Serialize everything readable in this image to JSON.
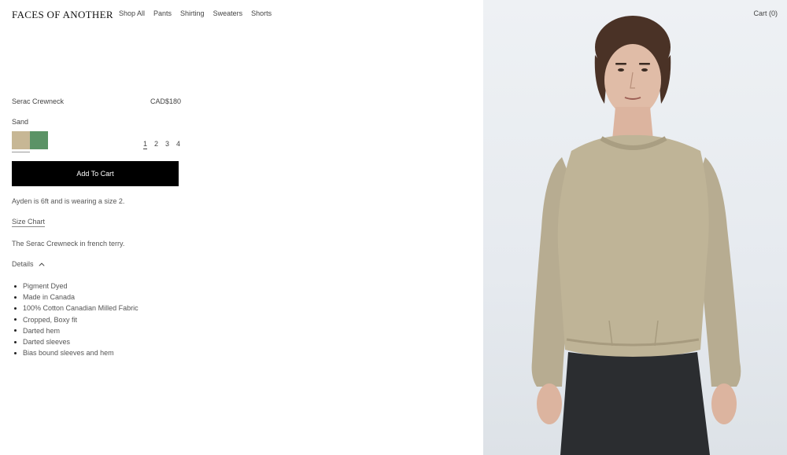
{
  "brand": "FACES OF ANOTHER",
  "nav": [
    "Shop All",
    "Pants",
    "Shirting",
    "Sweaters",
    "Shorts"
  ],
  "cart": "Cart (0)",
  "product": {
    "name": "Serac Crewneck",
    "price": "CAD$180",
    "color": "Sand",
    "swatch_colors": [
      "#c7b795",
      "#5b9366"
    ],
    "sizes": [
      "1",
      "2",
      "3",
      "4"
    ],
    "add_to_cart": "Add To Cart",
    "model_note": "Ayden is 6ft and is wearing a size 2.",
    "size_chart": "Size Chart",
    "description": "The Serac Crewneck in french terry.",
    "details_label": "Details",
    "details": [
      "Pigment Dyed",
      "Made in Canada",
      "100% Cotton Canadian Milled Fabric",
      "Cropped, Boxy fit",
      "Darted hem",
      "Darted sleeves",
      "Bias bound sleeves and hem"
    ]
  },
  "icons": {
    "details_toggle": "chevron-up-icon"
  }
}
